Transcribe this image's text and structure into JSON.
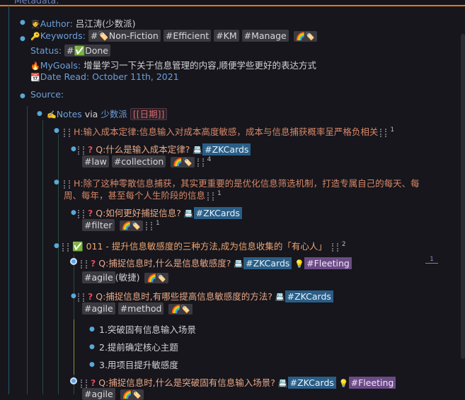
{
  "header": {
    "cut_label": "Metadata:"
  },
  "metadata": {
    "author_label": "Author:",
    "author_value": "吕江涛(少数派)",
    "keywords_label": "Keywords:",
    "keywords_tags": [
      "#🏷️Non-Fiction",
      "#Efficient",
      "#KM",
      "#Manage"
    ],
    "status_label": "Status:",
    "status_tag": "#✅Done",
    "mygoals_label": "MyGoals:",
    "mygoals_value": "增量学习一下关于信息管理的内容,顺便学些更好的表达方式",
    "date_label": "Date Read:",
    "date_value": "October 11th, 2021"
  },
  "source": {
    "label": "Source:",
    "notes_label": "Notes",
    "via_text": "via",
    "via_link": "少数派",
    "ref_text": "[[日期]]"
  },
  "blocks": [
    {
      "h_text": "H:输入成本定律:信息输入对成本高度敏感，成本与信息捕获概率呈严格负相关",
      "sup": "1"
    },
    {
      "q_text": "Q:什么是输入成本定律?",
      "tag": "#ZKCards",
      "tags2": [
        "#law",
        "#collection"
      ],
      "sup": "4"
    },
    {
      "h_text": "H:除了这种零散信息捕获，其实更重要的是优化信息筛选机制，打造专属自己的每天、每",
      "h_text2": "周、每年，甚至每个人生阶段的信息",
      "sup": "1"
    },
    {
      "q_text": "Q:如何更好捕捉信息?",
      "tag": "#ZKCards",
      "tags2": [
        "#filter"
      ],
      "sup": "1"
    },
    {
      "check_text": "011 - 提升信息敏感度的三种方法,成为信息收集的「有心人」",
      "sup": "2"
    },
    {
      "q_text": "Q:捕捉信息时,什么是信息敏感度?",
      "tag": "#ZKCards",
      "tag2": "#Fleeting",
      "tags2": [
        "#agile"
      ],
      "extra": "(敏捷)",
      "right_num": "1"
    },
    {
      "q_text": "Q:捕捉信息时,有哪些提高信息敏感度的方法?",
      "tag": "#ZKCards",
      "tags2": [
        "#agile",
        "#method"
      ]
    },
    {
      "list": [
        "1.突破固有信息输入场景",
        "2.提前确定核心主题",
        "3.用项目提升敏感度"
      ]
    },
    {
      "q_text": "Q:捕捉信息时,什么是突破固有信息输入场景?",
      "tag": "#ZKCards",
      "tag2": "#Fleeting",
      "tags2": [
        "#agile"
      ]
    }
  ]
}
